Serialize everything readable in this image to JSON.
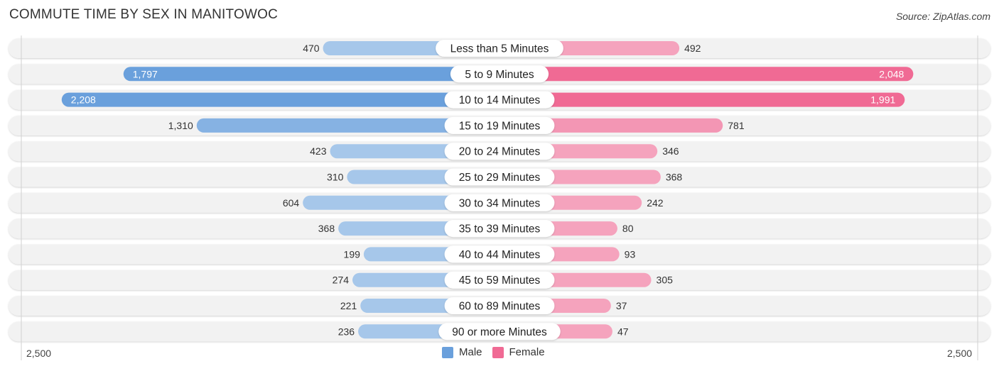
{
  "header": {
    "title": "COMMUTE TIME BY SEX IN MANITOWOC",
    "source": "Source: ZipAtlas.com"
  },
  "colors": {
    "male_strong": "#6aa0dc",
    "male_light": "#a6c7ea",
    "female_strong": "#f06a94",
    "female_light": "#f5a3bd",
    "row_bg": "#f2f2f2"
  },
  "chart_data": {
    "type": "bar",
    "orientation": "horizontal-diverging",
    "title": "COMMUTE TIME BY SEX IN MANITOWOC",
    "categories": [
      "Less than 5 Minutes",
      "5 to 9 Minutes",
      "10 to 14 Minutes",
      "15 to 19 Minutes",
      "20 to 24 Minutes",
      "25 to 29 Minutes",
      "30 to 34 Minutes",
      "35 to 39 Minutes",
      "40 to 44 Minutes",
      "45 to 59 Minutes",
      "60 to 89 Minutes",
      "90 or more Minutes"
    ],
    "series": [
      {
        "name": "Male",
        "side": "left",
        "values": [
          470,
          1797,
          2208,
          1310,
          423,
          310,
          604,
          368,
          199,
          274,
          221,
          236
        ]
      },
      {
        "name": "Female",
        "side": "right",
        "values": [
          492,
          2048,
          1991,
          781,
          346,
          368,
          242,
          80,
          93,
          305,
          37,
          47
        ]
      }
    ],
    "value_labels": {
      "Male": [
        "470",
        "1,797",
        "2,208",
        "1,310",
        "423",
        "310",
        "604",
        "368",
        "199",
        "274",
        "221",
        "236"
      ],
      "Female": [
        "492",
        "2,048",
        "1,991",
        "781",
        "346",
        "368",
        "242",
        "80",
        "93",
        "305",
        "37",
        "47"
      ]
    },
    "axis": {
      "min_label": "2,500",
      "max_label": "2,500",
      "range": [
        0,
        2500
      ]
    },
    "legend": {
      "position": "bottom-center",
      "entries": [
        "Male",
        "Female"
      ]
    },
    "grid": false
  }
}
